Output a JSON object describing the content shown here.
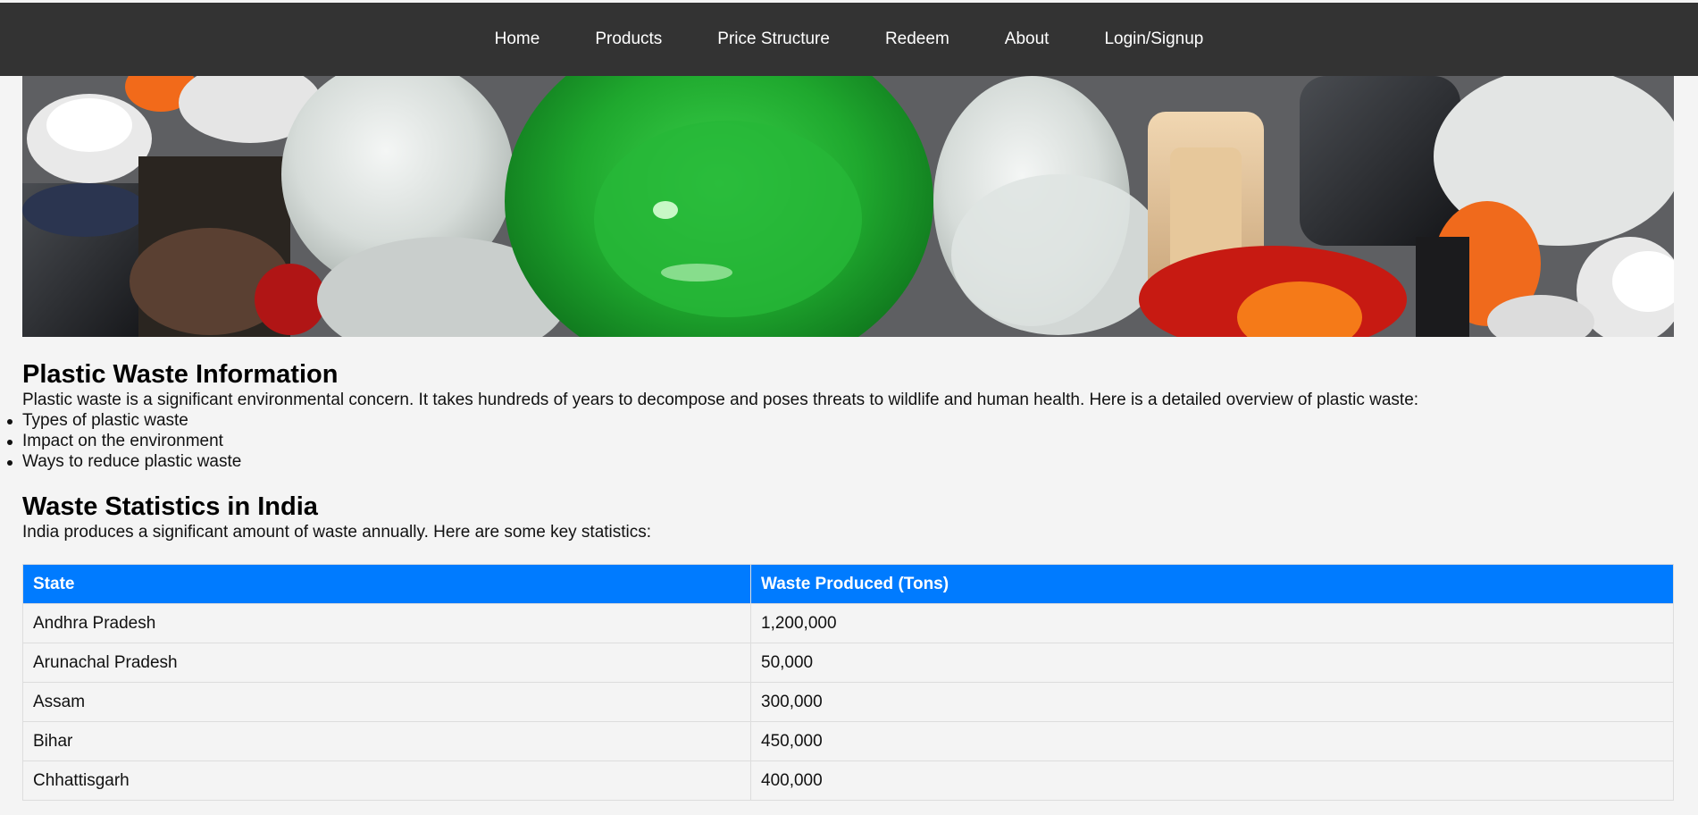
{
  "nav": {
    "items": [
      {
        "label": "Home"
      },
      {
        "label": "Products"
      },
      {
        "label": "Price Structure"
      },
      {
        "label": "Redeem"
      },
      {
        "label": "About"
      },
      {
        "label": "Login/Signup"
      }
    ]
  },
  "hero": {
    "image": "plastic-waste-photo"
  },
  "info": {
    "title": "Plastic Waste Information",
    "description": "Plastic waste is a significant environmental concern. It takes hundreds of years to decompose and poses threats to wildlife and human health. Here is a detailed overview of plastic waste:",
    "list": [
      "Types of plastic waste",
      "Impact on the environment",
      "Ways to reduce plastic waste"
    ]
  },
  "stats": {
    "title": "Waste Statistics in India",
    "description": "India produces a significant amount of waste annually. Here are some key statistics:",
    "columns": [
      "State",
      "Waste Produced (Tons)"
    ],
    "rows": [
      [
        "Andhra Pradesh",
        "1,200,000"
      ],
      [
        "Arunachal Pradesh",
        "50,000"
      ],
      [
        "Assam",
        "300,000"
      ],
      [
        "Bihar",
        "450,000"
      ],
      [
        "Chhattisgarh",
        "400,000"
      ]
    ]
  },
  "colors": {
    "nav_bg": "#333333",
    "table_header_bg": "#007bff",
    "page_bg": "#f4f4f4"
  }
}
